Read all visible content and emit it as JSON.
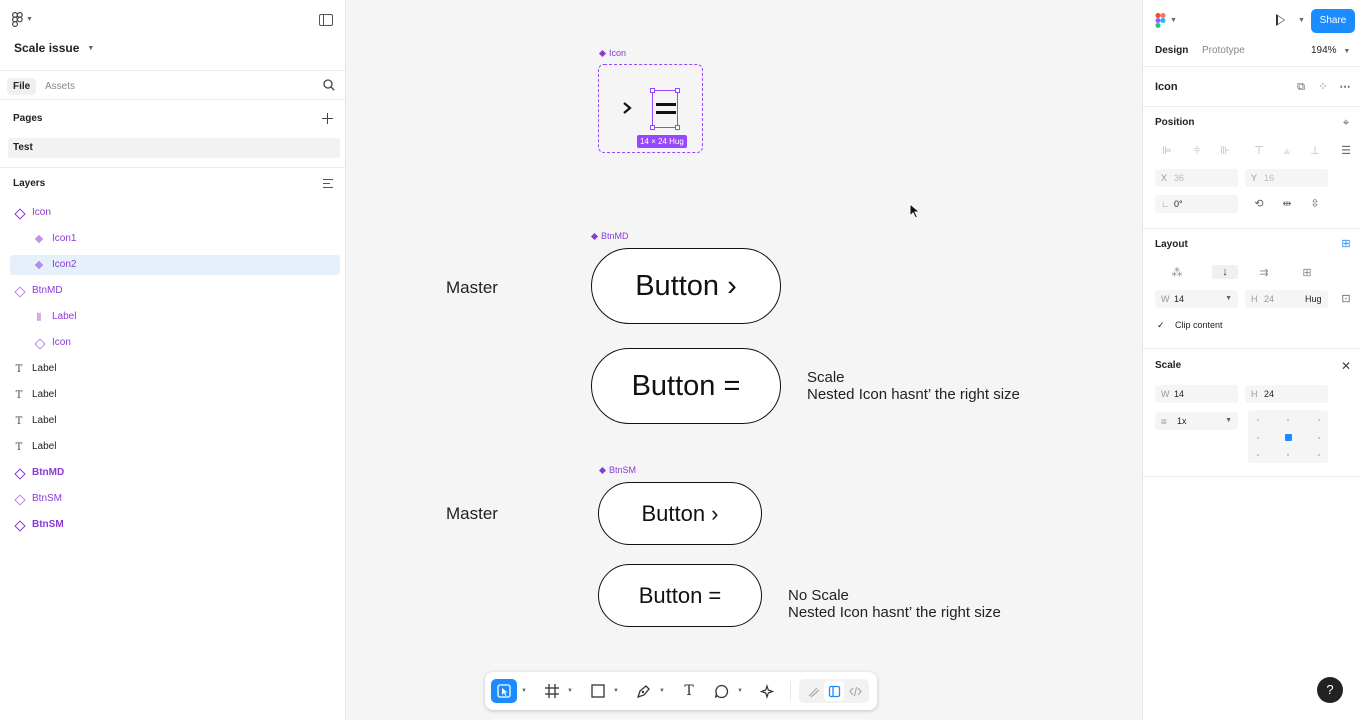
{
  "file": {
    "name": "Scale issue"
  },
  "left_tabs": {
    "file": "File",
    "assets": "Assets"
  },
  "pages": {
    "title": "Pages",
    "items": [
      {
        "label": "Test"
      }
    ]
  },
  "layers": {
    "title": "Layers",
    "items": [
      {
        "label": "Icon",
        "kind": "component"
      },
      {
        "label": "Icon1",
        "kind": "instance"
      },
      {
        "label": "Icon2",
        "kind": "instance",
        "selected": true
      },
      {
        "label": "BtnMD",
        "kind": "instance-outline"
      },
      {
        "label": "Label",
        "kind": "autolayout"
      },
      {
        "label": "Icon",
        "kind": "instance-outline"
      },
      {
        "label": "Label",
        "kind": "text"
      },
      {
        "label": "Label",
        "kind": "text"
      },
      {
        "label": "Label",
        "kind": "text"
      },
      {
        "label": "Label",
        "kind": "text"
      },
      {
        "label": "BtnMD",
        "kind": "component"
      },
      {
        "label": "BtnSM",
        "kind": "instance-outline"
      },
      {
        "label": "BtnSM",
        "kind": "component"
      }
    ]
  },
  "canvas": {
    "icon_frame_label": "Icon",
    "size_tag": "14 × 24 Hug",
    "btnmd_label": "BtnMD",
    "btnsm_label": "BtnSM",
    "master_md": "Master",
    "master_sm": "Master",
    "btn_md_master": "Button ›",
    "btn_md_scaled": "Button =",
    "btn_sm_master": "Button ›",
    "btn_sm_noscale": "Button =",
    "note_scale_title": "Scale",
    "note_scale_body": "Nested Icon hasnt’ the right size",
    "note_noscale_title": "No Scale",
    "note_noscale_body": "Nested Icon hasnt’ the right size"
  },
  "right": {
    "share": "Share",
    "tab_design": "Design",
    "tab_prototype": "Prototype",
    "zoom": "194%",
    "selection_title": "Icon",
    "position": {
      "title": "Position",
      "x_key": "X",
      "x": "36",
      "y_key": "Y",
      "y": "16",
      "rotation": "0°"
    },
    "layout": {
      "title": "Layout",
      "w_key": "W",
      "w": "14",
      "h_key": "H",
      "h": "24",
      "hug": "Hug",
      "clip": "Clip content"
    },
    "scale": {
      "title": "Scale",
      "w_key": "W",
      "w": "14",
      "h_key": "H",
      "h": "24",
      "factor": "1x"
    }
  },
  "colors": {
    "accent": "#1a8cff",
    "component": "#9747ff",
    "component_text": "#8a3ad8"
  }
}
